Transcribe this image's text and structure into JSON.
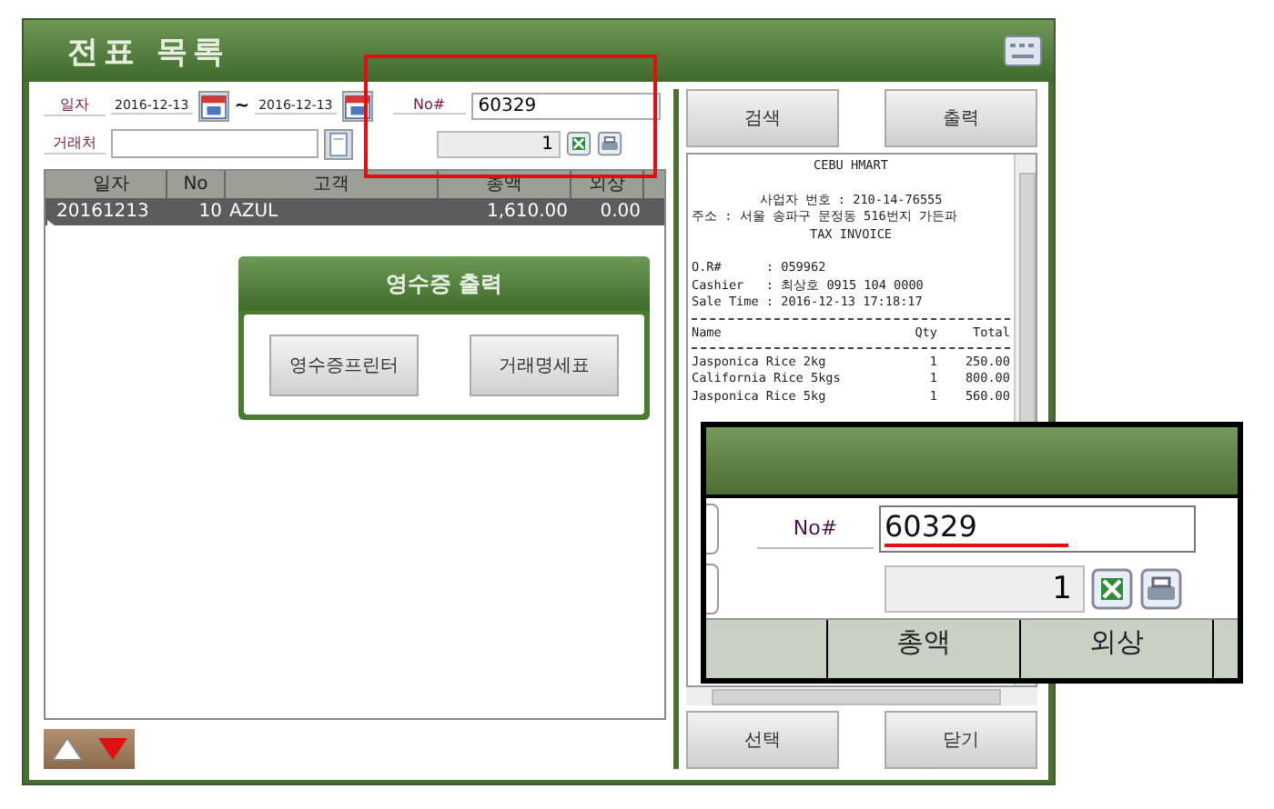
{
  "window": {
    "title": "전표 목록"
  },
  "filters": {
    "date_label": "일자",
    "date_from": "2016-12-13",
    "range_sep": "~",
    "date_to": "2016-12-13",
    "customer_label": "거래처",
    "no_label": "No#",
    "no_value": "60329",
    "count": "1"
  },
  "actions": {
    "search": "검색",
    "print": "출력",
    "select": "선택",
    "close": "닫기"
  },
  "grid": {
    "columns": [
      "일자",
      "No",
      "고객",
      "총액",
      "외상"
    ],
    "rows": [
      {
        "date": "20161213",
        "no": "10",
        "customer": "AZUL",
        "total": "1,610.00",
        "credit": "0.00",
        "selected": true
      }
    ]
  },
  "popup": {
    "title": "영수증 출력",
    "buttons": [
      "영수증프린터",
      "거래명세표"
    ]
  },
  "receipt": {
    "lines": [
      {
        "kind": "center",
        "text": "CEBU HMART"
      },
      {
        "kind": "blank"
      },
      {
        "kind": "center",
        "text": "사업자 번호 : 210-14-76555"
      },
      {
        "kind": "left",
        "text": "주소 : 서울 송파구 문정동 516번지 가든파"
      },
      {
        "kind": "center",
        "text": "TAX INVOICE"
      },
      {
        "kind": "blank"
      },
      {
        "kind": "left",
        "text": "O.R#      : 059962"
      },
      {
        "kind": "left",
        "text": "Cashier   : 최상호 0915 104 0000"
      },
      {
        "kind": "left",
        "text": "Sale Time : 2016-12-13 17:18:17"
      },
      {
        "kind": "rule"
      },
      {
        "kind": "cols",
        "cells": [
          "Name",
          "Qty",
          "Total"
        ]
      },
      {
        "kind": "rule"
      },
      {
        "kind": "cols",
        "cells": [
          "Jasponica Rice 2kg",
          "1",
          "250.00"
        ]
      },
      {
        "kind": "cols",
        "cells": [
          "California Rice 5kgs",
          "1",
          "800.00"
        ]
      },
      {
        "kind": "cols",
        "cells": [
          "Jasponica Rice 5kg",
          "1",
          "560.00"
        ]
      }
    ]
  },
  "callout": {
    "no_label": "No#",
    "no_value": "60329",
    "count": "1",
    "columns": [
      "총액",
      "외상"
    ]
  }
}
